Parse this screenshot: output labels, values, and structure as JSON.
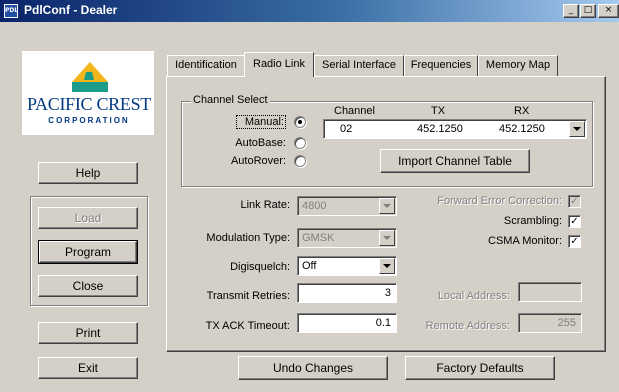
{
  "window": {
    "title": "PdlConf - Dealer",
    "app_icon_text": "PDL",
    "controls": {
      "minimize": "_",
      "maximize": "□",
      "close": "×"
    }
  },
  "logo": {
    "line1": "PACIFIC CREST",
    "line2": "CORPORATION",
    "colors": {
      "navy": "#003A80",
      "sail": "#F2B51C",
      "teal": "#1B9B8A"
    }
  },
  "sidebar": {
    "help": "Help",
    "load": "Load",
    "program": "Program",
    "close": "Close",
    "print": "Print",
    "exit": "Exit"
  },
  "tabs": [
    {
      "label": "Identification"
    },
    {
      "label": "Radio Link"
    },
    {
      "label": "Serial Interface"
    },
    {
      "label": "Frequencies"
    },
    {
      "label": "Memory Map"
    }
  ],
  "channel_select": {
    "title": "Channel Select",
    "manual_label": "Manual:",
    "autobase_label": "AutoBase:",
    "autorover_label": "AutoRover:",
    "col_channel": "Channel",
    "col_tx": "TX",
    "col_rx": "RX",
    "channel": "02",
    "tx": "452.1250",
    "rx": "452.1250",
    "import_button": "Import Channel Table"
  },
  "settings": {
    "link_rate_label": "Link Rate:",
    "link_rate_value": "4800",
    "modulation_label": "Modulation Type:",
    "modulation_value": "GMSK",
    "digisquelch_label": "Digisquelch:",
    "digisquelch_value": "Off",
    "retries_label": "Transmit Retries:",
    "retries_value": "3",
    "ack_timeout_label": "TX ACK Timeout:",
    "ack_timeout_value": "0.1"
  },
  "options": {
    "fec_label": "Forward Error Correction:",
    "scrambling_label": "Scrambling:",
    "csma_label": "CSMA Monitor:",
    "check_mark": "✓",
    "local_address_label": "Local Address:",
    "local_address_value": "",
    "remote_address_label": "Remote Address:",
    "remote_address_value": "255"
  },
  "footer": {
    "undo": "Undo Changes",
    "factory": "Factory Defaults"
  }
}
